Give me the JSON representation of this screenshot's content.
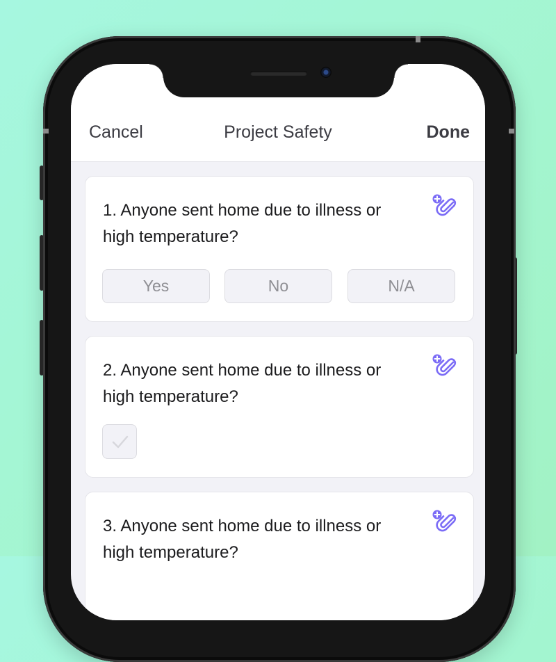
{
  "nav": {
    "cancel_label": "Cancel",
    "title": "Project Safety",
    "done_label": "Done"
  },
  "questions": [
    {
      "text": "1. Anyone sent home due to illness or high temperature?",
      "input_type": "options",
      "options": [
        "Yes",
        "No",
        "N/A"
      ],
      "selected": null,
      "attach_icon": "paperclip-plus-icon"
    },
    {
      "text": "2. Anyone sent home due to illness or high temperature?",
      "input_type": "checkbox",
      "checked": false,
      "attach_icon": "paperclip-plus-icon"
    },
    {
      "text": "3. Anyone sent home due to illness or high temperature?",
      "input_type": "unknown",
      "attach_icon": "paperclip-plus-icon"
    }
  ],
  "colors": {
    "accent": "#7b6cf6",
    "background_gradient_start": "#a6f7e0",
    "background_gradient_end": "#a2f2c4",
    "screen_background": "#f2f2f7",
    "text_primary": "#1c1c1e",
    "text_muted": "#8e8e93"
  }
}
